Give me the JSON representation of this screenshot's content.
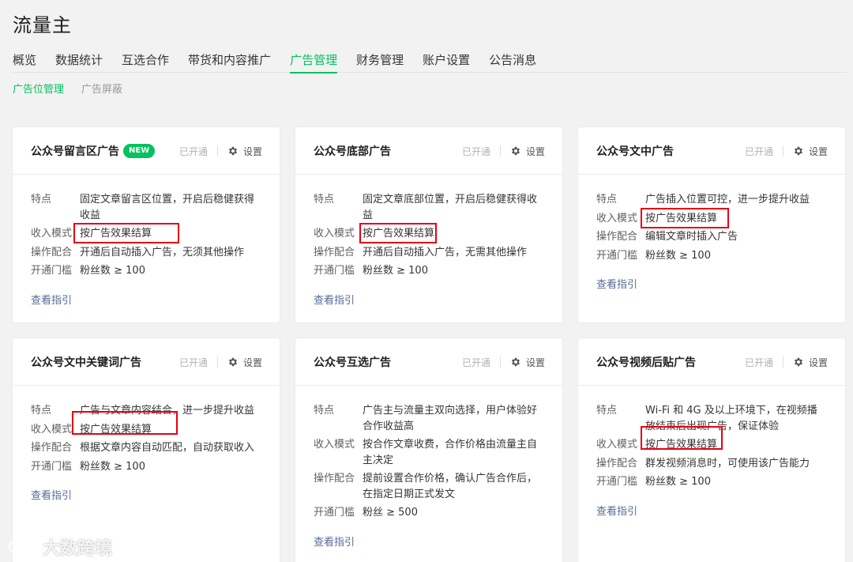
{
  "header": {
    "title": "流量主"
  },
  "tabs": [
    {
      "label": "概览"
    },
    {
      "label": "数据统计"
    },
    {
      "label": "互选合作"
    },
    {
      "label": "带货和内容推广"
    },
    {
      "label": "广告管理",
      "active": true
    },
    {
      "label": "财务管理"
    },
    {
      "label": "账户设置"
    },
    {
      "label": "公告消息"
    }
  ],
  "subtabs": [
    {
      "label": "广告位管理",
      "active": true
    },
    {
      "label": "广告屏蔽"
    }
  ],
  "labels": {
    "status": "已开通",
    "settings": "设置",
    "guide": "查看指引",
    "feature": "特点",
    "income": "收入模式",
    "operation": "操作配合",
    "threshold": "开通门槛",
    "new_badge": "NEW"
  },
  "cards": [
    {
      "title": "公众号留言区广告",
      "feature": "固定文章留言区位置，开启后稳健获得收益",
      "income": "按广告效果结算",
      "operation": "开通后自动插入广告，无须其他操作",
      "threshold": "粉丝数 ≥ 100"
    },
    {
      "title": "公众号底部广告",
      "feature": "固定文章底部位置，开启后稳健获得收益",
      "income": "按广告效果结算",
      "operation": "开通后自动插入广告，无需其他操作",
      "threshold": "粉丝数 ≥ 100"
    },
    {
      "title": "公众号文中广告",
      "feature": "广告插入位置可控，进一步提升收益",
      "income": "按广告效果结算",
      "operation": "编辑文章时插入广告",
      "threshold": "粉丝数 ≥ 100"
    },
    {
      "title": "公众号文中关键词广告",
      "feature": "广告与文章内容结合，进一步提升收益",
      "income": "按广告效果结算",
      "operation": "根据文章内容自动匹配，自动获取收入",
      "threshold": "粉丝数 ≥ 100"
    },
    {
      "title": "公众号互选广告",
      "feature": "广告主与流量主双向选择，用户体验好合作收益高",
      "income": "按合作文章收费，合作价格由流量主自主决定",
      "operation": "提前设置合作价格，确认广告合作后，在指定日期正式发文",
      "threshold": "粉丝 ≥ 500"
    },
    {
      "title": "公众号视频后贴广告",
      "feature": "Wi-Fi 和 4G 及以上环境下，在视频播放结束后出现广告，保证体验",
      "income": "按广告效果结算",
      "operation": "群发视频消息时，可使用该广告能力",
      "threshold": "粉丝数 ≥ 100"
    }
  ],
  "watermark": {
    "text": "大数跨境"
  },
  "colors": {
    "accent": "#07c160",
    "link": "#576b95",
    "highlight_box": "#e60012"
  }
}
